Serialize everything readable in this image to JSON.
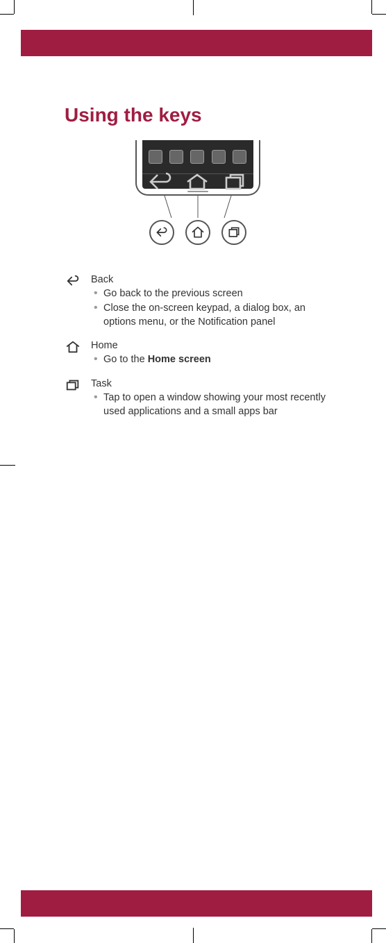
{
  "title": "Using the keys",
  "keys": [
    {
      "name": "Back",
      "bullets": [
        "Go back to the previous screen",
        "Close the on-screen keypad, a dialog box, an options menu, or the Notification panel"
      ]
    },
    {
      "name": "Home",
      "bullets_prefix": "Go to the ",
      "bullets_bold": "Home screen"
    },
    {
      "name": "Task",
      "bullets": [
        "Tap to open a window showing your most recently used applications and a small apps bar"
      ]
    }
  ]
}
